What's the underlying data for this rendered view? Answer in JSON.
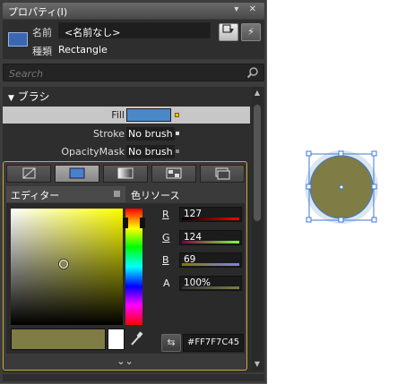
{
  "panel": {
    "title": "プロパティ(I)",
    "controls": [
      "▼",
      "✕"
    ]
  },
  "header": {
    "name_label": "名前",
    "name_value": "<名前なし>",
    "type_label": "種類",
    "type_value": "Rectangle"
  },
  "search": {
    "placeholder": "Search"
  },
  "category": {
    "title": "ブラシ"
  },
  "properties": [
    {
      "name": "Fill",
      "value": ""
    },
    {
      "name": "Stroke",
      "value": "No brush"
    },
    {
      "name": "OpacityMask",
      "value": "No brush"
    }
  ],
  "editor": {
    "tab_editor": "エディター",
    "tab_resources": "色リソース",
    "channels": [
      {
        "label": "R",
        "value": "127"
      },
      {
        "label": "G",
        "value": "124"
      },
      {
        "label": "B",
        "value": "69"
      },
      {
        "label": "A",
        "value": "100%"
      }
    ],
    "hex": "#FF7F7C45",
    "expand_glyph": "⌄⌄"
  },
  "colors": {
    "selected": "#7F7C45",
    "fill_property": "#4A88C8",
    "accent_border": "#C9A93A"
  },
  "icons": [
    "rectangle-icon",
    "search-icon",
    "no-brush-icon",
    "solid-brush-icon",
    "gradient-brush-icon",
    "tile-brush-icon",
    "resource-brush-icon",
    "eyedropper-icon",
    "swap-icon",
    "expand-icon"
  ]
}
